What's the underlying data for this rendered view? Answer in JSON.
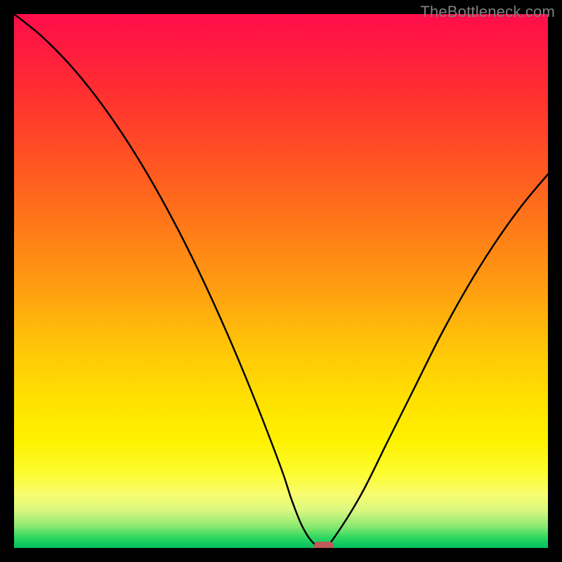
{
  "watermark": "TheBottleneck.com",
  "colors": {
    "background": "#000000",
    "watermark": "#808080",
    "curve": "#000000",
    "marker": "#c05a5a",
    "gradient_top": "#ff0d4a",
    "gradient_bottom": "#00c060"
  },
  "chart_data": {
    "type": "line",
    "title": "",
    "xlabel": "",
    "ylabel": "",
    "xlim": [
      0,
      100
    ],
    "ylim": [
      0,
      100
    ],
    "grid": false,
    "legend": false,
    "series": [
      {
        "name": "bottleneck-curve",
        "x": [
          0,
          5,
          10,
          15,
          20,
          25,
          30,
          35,
          40,
          45,
          50,
          52,
          54,
          56,
          58,
          60,
          65,
          70,
          75,
          80,
          85,
          90,
          95,
          100
        ],
        "y": [
          100,
          96,
          91,
          85,
          78,
          70,
          61,
          51,
          40,
          28,
          15,
          9,
          4,
          1,
          0,
          2,
          10,
          20,
          30,
          40,
          49,
          57,
          64,
          70
        ]
      }
    ],
    "annotations": [
      {
        "name": "min-marker",
        "x": 58,
        "y": 0
      }
    ],
    "background": "vertical-gradient red→yellow→green (value decreases downward)"
  }
}
